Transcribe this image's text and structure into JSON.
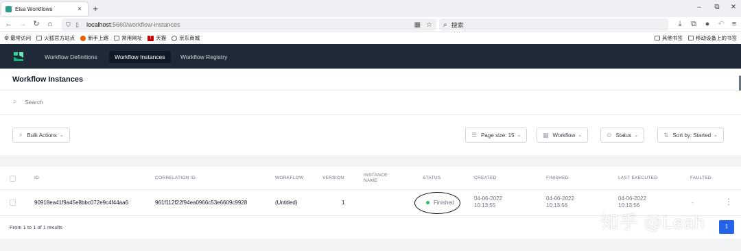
{
  "browser": {
    "tab_title": "Elsa Workflows",
    "tab_close": "×",
    "new_tab": "+",
    "window_min": "–",
    "window_max": "⧉",
    "window_close": "✕",
    "url_host": "localhost",
    "url_path": ":5660/workflow-instances",
    "search_placeholder": "搜索",
    "bookmarks": [
      "最常访问",
      "火狐官方站点",
      "新手上路",
      "常用网址",
      "天猫",
      "京东商城"
    ],
    "bookmarks_right": [
      "其他书签",
      "移动设备上的书签"
    ]
  },
  "app": {
    "nav": [
      "Workflow Definitions",
      "Workflow Instances",
      "Workflow Registry"
    ],
    "page_title": "Workflow Instances",
    "search_placeholder": "Search",
    "bulk_actions": "Bulk Actions",
    "page_size": "Page size: 15",
    "workflow_filter": "Workflow",
    "status_filter": "Status",
    "sort_by": "Sort by: Started"
  },
  "table": {
    "headers": {
      "id": "ID",
      "correlation": "CORRELATION ID",
      "workflow": "WORKFLOW",
      "version": "VERSION",
      "instance_line1": "INSTANCE",
      "instance_line2": "NAME",
      "status": "STATUS",
      "created": "CREATED",
      "finished": "FINISHED",
      "last_executed": "LAST EXECUTED",
      "faulted": "FAULTED"
    },
    "rows": [
      {
        "id": "90918ea41f9a45e8bbc072e9c4f44aa6",
        "correlation": "961f112f22f94ea0966c53e6609c9928",
        "workflow": "(Untitled)",
        "version": "1",
        "status": "Finished",
        "status_color": "#22c55e",
        "created_date": "04-06-2022",
        "created_time": "10:13:55",
        "finished_date": "04-06-2022",
        "finished_time": "10:13:56",
        "last_date": "04-06-2022",
        "last_time": "10:13:56",
        "faulted": "-"
      }
    ],
    "results_text": "From 1 to 1 of 1 results",
    "current_page": "1"
  },
  "watermark": "知乎 @Leah",
  "colors": {
    "header_bg": "#1f2937",
    "accent": "#2563eb"
  }
}
